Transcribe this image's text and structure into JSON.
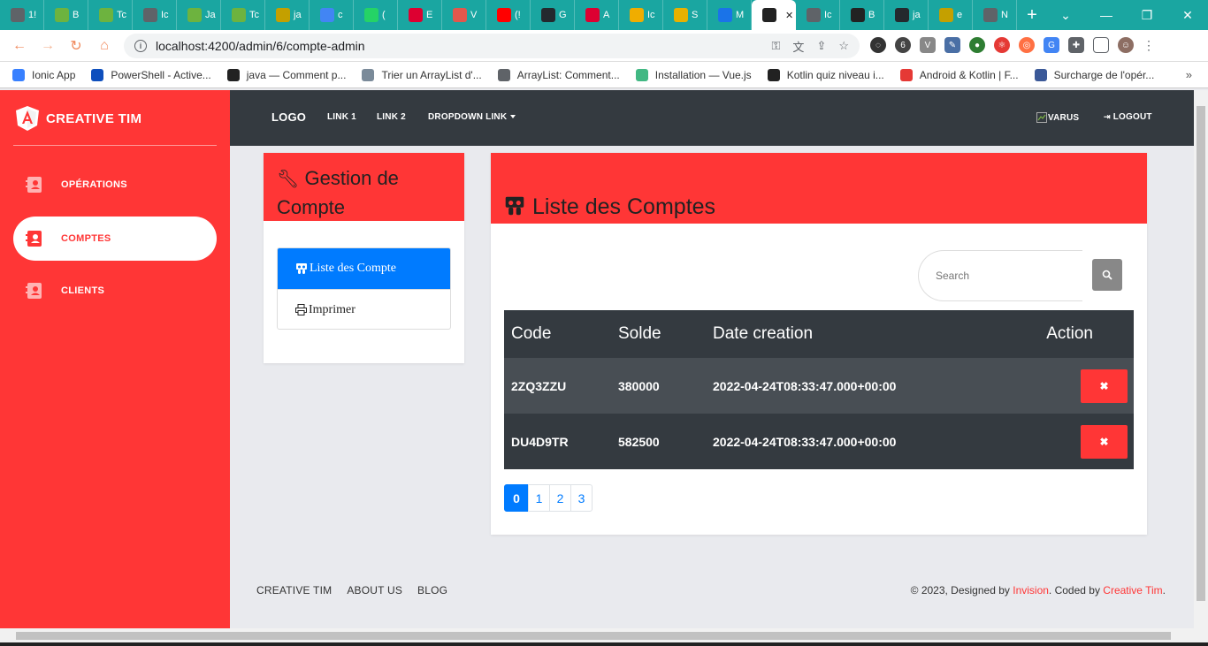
{
  "browser": {
    "tabs": [
      {
        "label": "1!",
        "color": "#5f6368",
        "icon": "globe-icon"
      },
      {
        "label": "B",
        "color": "#6db33f",
        "icon": "spring-icon"
      },
      {
        "label": "Tc",
        "color": "#6db33f",
        "icon": "spring-icon"
      },
      {
        "label": "Ic",
        "color": "#5f6368",
        "icon": "globe-icon"
      },
      {
        "label": "Ja",
        "color": "#6db33f",
        "icon": "spring-icon"
      },
      {
        "label": "Tc",
        "color": "#6db33f",
        "icon": "spring-icon"
      },
      {
        "label": "ja",
        "color": "#c4a000",
        "icon": "stack-icon"
      },
      {
        "label": "c",
        "color": "#4285f4",
        "icon": "google-icon"
      },
      {
        "label": "(",
        "color": "#25d366",
        "icon": "whatsapp-icon"
      },
      {
        "label": "E",
        "color": "#dd0031",
        "icon": "angular-icon"
      },
      {
        "label": "V",
        "color": "#e2574c",
        "icon": "gmail-icon"
      },
      {
        "label": "(!",
        "color": "#ff0000",
        "icon": "youtube-icon"
      },
      {
        "label": "G",
        "color": "#24292e",
        "icon": "github-icon"
      },
      {
        "label": "A",
        "color": "#dd0031",
        "icon": "angular-icon"
      },
      {
        "label": "Ic",
        "color": "#f0ad00",
        "icon": "mountain-icon"
      },
      {
        "label": "S",
        "color": "#e8b100",
        "icon": "d-icon"
      },
      {
        "label": "M",
        "color": "#1a73e8",
        "icon": "mail-icon"
      },
      {
        "label": "",
        "color": "#222222",
        "icon": "angular-icon",
        "active": true
      },
      {
        "label": "Ic",
        "color": "#5f6368",
        "icon": "globe-icon"
      },
      {
        "label": "B",
        "color": "#222222",
        "icon": "angular-icon"
      },
      {
        "label": "ja",
        "color": "#24292e",
        "icon": "github-icon"
      },
      {
        "label": "e",
        "color": "#c4a000",
        "icon": "stack-icon"
      },
      {
        "label": "N",
        "color": "#5f6368",
        "icon": "globe-icon"
      }
    ],
    "url": "localhost:4200/admin/6/compte-admin",
    "bookmarks": [
      {
        "label": "Ionic App",
        "color": "#3880ff",
        "icon": "globe-icon"
      },
      {
        "label": "PowerShell - Active...",
        "color": "#0e4fbd",
        "icon": "io-icon"
      },
      {
        "label": "java — Comment p...",
        "color": "#222222",
        "icon": "stackoverflow-icon"
      },
      {
        "label": "Trier un ArrayList d'...",
        "color": "#7a8a99",
        "icon": "owl-icon"
      },
      {
        "label": "ArrayList: Comment...",
        "color": "#5f6368",
        "icon": "globe-icon"
      },
      {
        "label": "Installation — Vue.js",
        "color": "#41b883",
        "icon": "vue-icon"
      },
      {
        "label": "Kotlin quiz niveau i...",
        "color": "#222222",
        "icon": "s-icon"
      },
      {
        "label": "Android & Kotlin | F...",
        "color": "#e53935",
        "icon": "udemy-icon"
      },
      {
        "label": "Surcharge de l'opér...",
        "color": "#3b5998",
        "icon": "kotlin-icon"
      }
    ]
  },
  "sidebar": {
    "brand": "CREATIVE TIM",
    "items": [
      {
        "label": "OPÉRATIONS",
        "active": false
      },
      {
        "label": "COMPTES",
        "active": true
      },
      {
        "label": "CLIENTS",
        "active": false
      }
    ]
  },
  "navbar": {
    "logo": "LOGO",
    "link1": "LINK 1",
    "link2": "LINK 2",
    "dropdown": "DROPDOWN LINK",
    "user": "VARUS",
    "logout": "LOGOUT"
  },
  "left_card": {
    "title": "Gestion de Compte",
    "items": [
      {
        "label": "Liste des Compte",
        "active": true
      },
      {
        "label": "Imprimer",
        "active": false
      }
    ]
  },
  "right_card": {
    "title": "Liste des Comptes",
    "search_placeholder": "Search",
    "columns": [
      "Code",
      "Solde",
      "Date creation",
      "Action"
    ],
    "rows": [
      {
        "code": "2ZQ3ZZU",
        "solde": "380000",
        "date": "2022-04-24T08:33:47.000+00:00"
      },
      {
        "code": "DU4D9TR",
        "solde": "582500",
        "date": "2022-04-24T08:33:47.000+00:00"
      }
    ],
    "pages": [
      "0",
      "1",
      "2",
      "3"
    ],
    "active_page": "0"
  },
  "footer": {
    "links": [
      "CREATIVE TIM",
      "ABOUT US",
      "BLOG"
    ],
    "copy_prefix": "© 2023, Designed by ",
    "designer": "Invision",
    "copy_mid": ". Coded by ",
    "coder": "Creative Tim",
    "copy_suffix": "."
  },
  "colors": {
    "brand_red": "#ff3636",
    "navbar_dark": "#343a40",
    "primary_blue": "#007bff",
    "tabstrip": "#1aa6a1"
  }
}
